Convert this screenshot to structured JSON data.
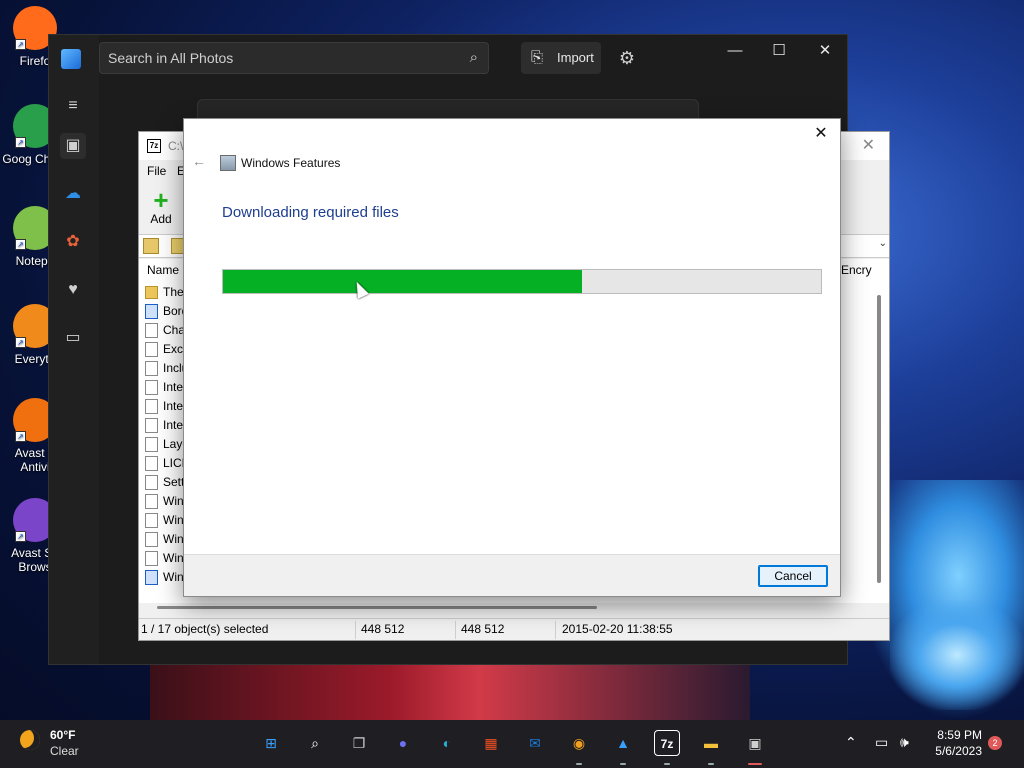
{
  "desktop": {
    "icons": [
      {
        "label": "Firefo",
        "icon": "firefox-icon",
        "color": "#ff6b1a"
      },
      {
        "label": "Goog Chron",
        "icon": "chrome-icon",
        "color": "#2a9f4b"
      },
      {
        "label": "Notepa",
        "icon": "notepad-icon",
        "color": "#7fc04a"
      },
      {
        "label": "Everyth",
        "icon": "everything-search-icon",
        "color": "#f08a1a"
      },
      {
        "label": "Avast F Antivi",
        "icon": "avast-antivirus-icon",
        "color": "#f07010"
      },
      {
        "label": "Avast Se Brows",
        "icon": "avast-browser-icon",
        "color": "#7b45c9"
      }
    ]
  },
  "photos": {
    "search_placeholder": "Search in All Photos",
    "import_label": "Import",
    "window_controls": {
      "minimize": "—",
      "maximize": "☐",
      "close": "✕"
    }
  },
  "sevenzip": {
    "title_partial": "C:\\",
    "logo": "7z",
    "menu": {
      "file": "File",
      "edit": "E"
    },
    "add_label": "Add",
    "columns": {
      "name": "Name",
      "encrypted": "Encry"
    },
    "rows": [
      {
        "name": "Ther",
        "type": "folder"
      },
      {
        "name": "Bord",
        "type": "blue"
      },
      {
        "name": "Cha",
        "type": "file"
      },
      {
        "name": "Excl",
        "type": "file"
      },
      {
        "name": "Inclu",
        "type": "file"
      },
      {
        "name": "Inter",
        "type": "file"
      },
      {
        "name": "Inter",
        "type": "file"
      },
      {
        "name": "Inter",
        "type": "file"
      },
      {
        "name": "Laye",
        "type": "file"
      },
      {
        "name": "LICE",
        "type": "file"
      },
      {
        "name": "Setti",
        "type": "file"
      },
      {
        "name": "Win",
        "type": "file"
      },
      {
        "name": "Win",
        "type": "file"
      },
      {
        "name": "Win",
        "type": "file"
      },
      {
        "name": "Win",
        "type": "file"
      },
      {
        "name": "Win",
        "type": "blue"
      }
    ],
    "status": {
      "selected": "1 / 17 object(s) selected",
      "size": "448 512",
      "packed": "448 512",
      "modified": "2015-02-20 11:38:55"
    }
  },
  "dialog": {
    "title": "Windows Features",
    "heading": "Downloading required files",
    "progress": 0.6,
    "cancel_label": "Cancel",
    "colors": {
      "progress": "#06b025",
      "heading": "#1e3e8f"
    }
  },
  "taskbar": {
    "weather": {
      "temp": "60°F",
      "condition": "Clear"
    },
    "apps": [
      {
        "name": "start",
        "icon": "windows-start-icon",
        "glyph": "⊞",
        "color": "#3aa0ff"
      },
      {
        "name": "search",
        "icon": "search-icon",
        "glyph": "⌕",
        "color": "#ffffff"
      },
      {
        "name": "task-view",
        "icon": "task-view-icon",
        "glyph": "❐",
        "color": "#cfcfcf"
      },
      {
        "name": "chat",
        "icon": "chat-icon",
        "glyph": "●",
        "color": "#6b6ff0"
      },
      {
        "name": "edge",
        "icon": "edge-icon",
        "glyph": "◐",
        "color": "#2bb0d8"
      },
      {
        "name": "store",
        "icon": "store-icon",
        "glyph": "▦",
        "color": "#f25022"
      },
      {
        "name": "mail",
        "icon": "mail-icon",
        "glyph": "✉",
        "color": "#1a7ad8"
      },
      {
        "name": "avast-browser",
        "icon": "avast-browser-icon",
        "glyph": "◉",
        "color": "#f0a020"
      },
      {
        "name": "photos",
        "icon": "photos-icon",
        "glyph": "▲",
        "color": "#3aa0ff"
      },
      {
        "name": "7zip",
        "icon": "7zip-icon",
        "glyph": "7z",
        "color": "#ffffff"
      },
      {
        "name": "explorer",
        "icon": "file-explorer-icon",
        "glyph": "▬",
        "color": "#f2c23a"
      },
      {
        "name": "windows-features",
        "icon": "windows-features-icon",
        "glyph": "▣",
        "color": "#cfcfcf"
      }
    ],
    "time": "8:59 PM",
    "date": "5/6/2023",
    "notification_count": "2"
  }
}
